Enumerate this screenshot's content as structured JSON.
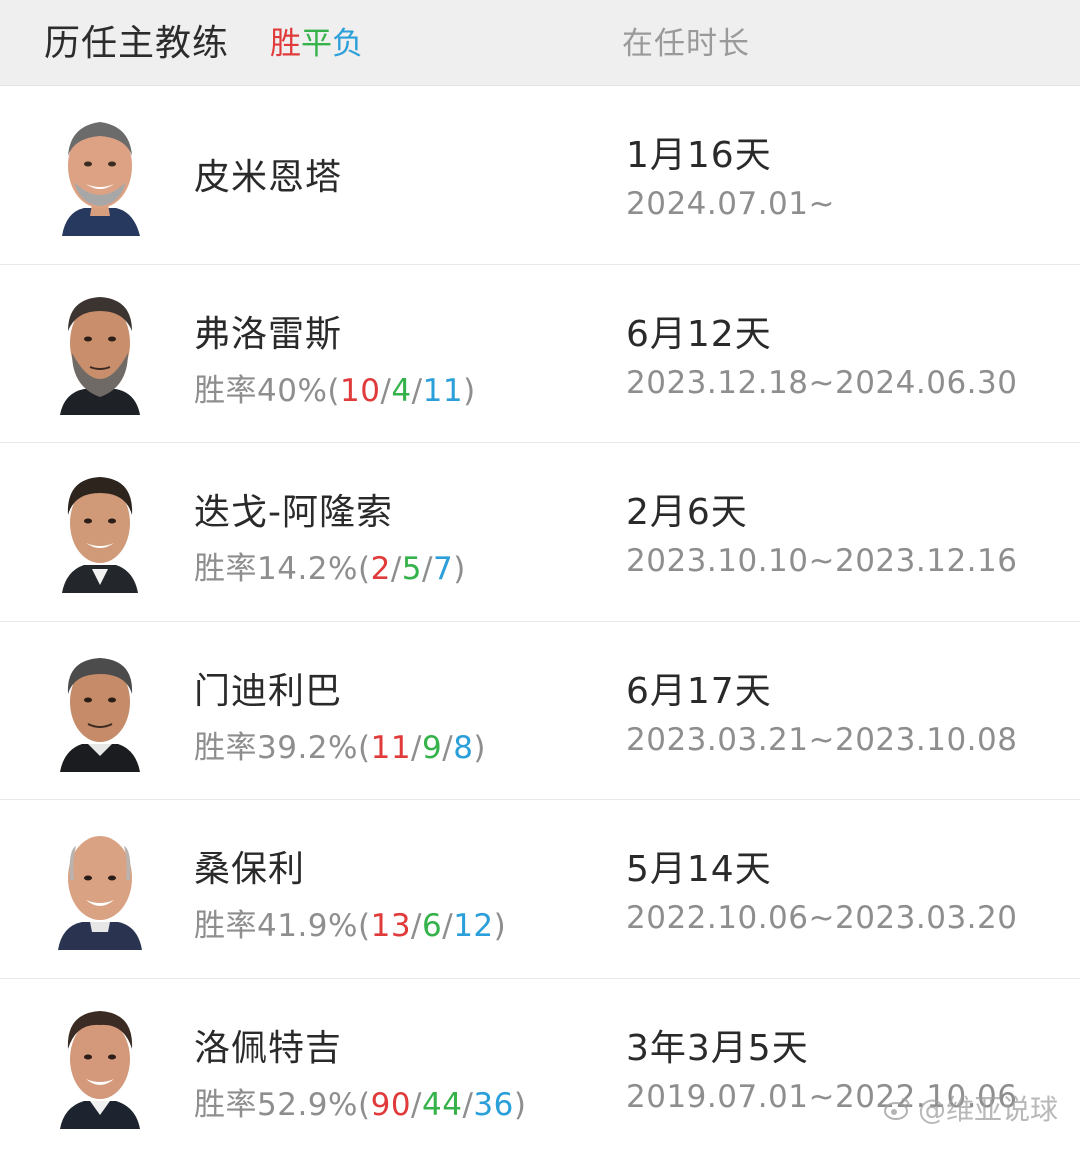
{
  "header": {
    "title": "历任主教练",
    "legend_win": "胜",
    "legend_draw": "平",
    "legend_loss": "负",
    "tenure_label": "在任时长"
  },
  "coaches": [
    {
      "name": "皮米恩塔",
      "rate_prefix": "",
      "wins": "",
      "draws": "",
      "losses": "",
      "duration": "1月16天",
      "dates": "2024.07.01~",
      "avatar_icon": "coach-photo-bald-smiling"
    },
    {
      "name": "弗洛雷斯",
      "rate_prefix": "胜率40%",
      "wins": "10",
      "draws": "4",
      "losses": "11",
      "duration": "6月12天",
      "dates": "2023.12.18~2024.06.30",
      "avatar_icon": "coach-photo-bearded"
    },
    {
      "name": "迭戈-阿隆索",
      "rate_prefix": "胜率14.2%",
      "wins": "2",
      "draws": "5",
      "losses": "7",
      "duration": "2月6天",
      "dates": "2023.10.10~2023.12.16",
      "avatar_icon": "coach-photo-dark-hair"
    },
    {
      "name": "门迪利巴",
      "rate_prefix": "胜率39.2%",
      "wins": "11",
      "draws": "9",
      "losses": "8",
      "duration": "6月17天",
      "dates": "2023.03.21~2023.10.08",
      "avatar_icon": "coach-photo-grey-hair"
    },
    {
      "name": "桑保利",
      "rate_prefix": "胜率41.9%",
      "wins": "13",
      "draws": "6",
      "losses": "12",
      "duration": "5月14天",
      "dates": "2022.10.06~2023.03.20",
      "avatar_icon": "coach-photo-bald"
    },
    {
      "name": "洛佩特吉",
      "rate_prefix": "胜率52.9%",
      "wins": "90",
      "draws": "44",
      "losses": "36",
      "duration": "3年3月5天",
      "dates": "2019.07.01~2022.10.06",
      "avatar_icon": "coach-photo-slick-hair"
    }
  ],
  "watermark": {
    "text": "@维亚说球"
  },
  "colors": {
    "win": "#e03a3a",
    "draw": "#35b24a",
    "loss": "#2b9fd9",
    "header_bg": "#efeff0"
  }
}
